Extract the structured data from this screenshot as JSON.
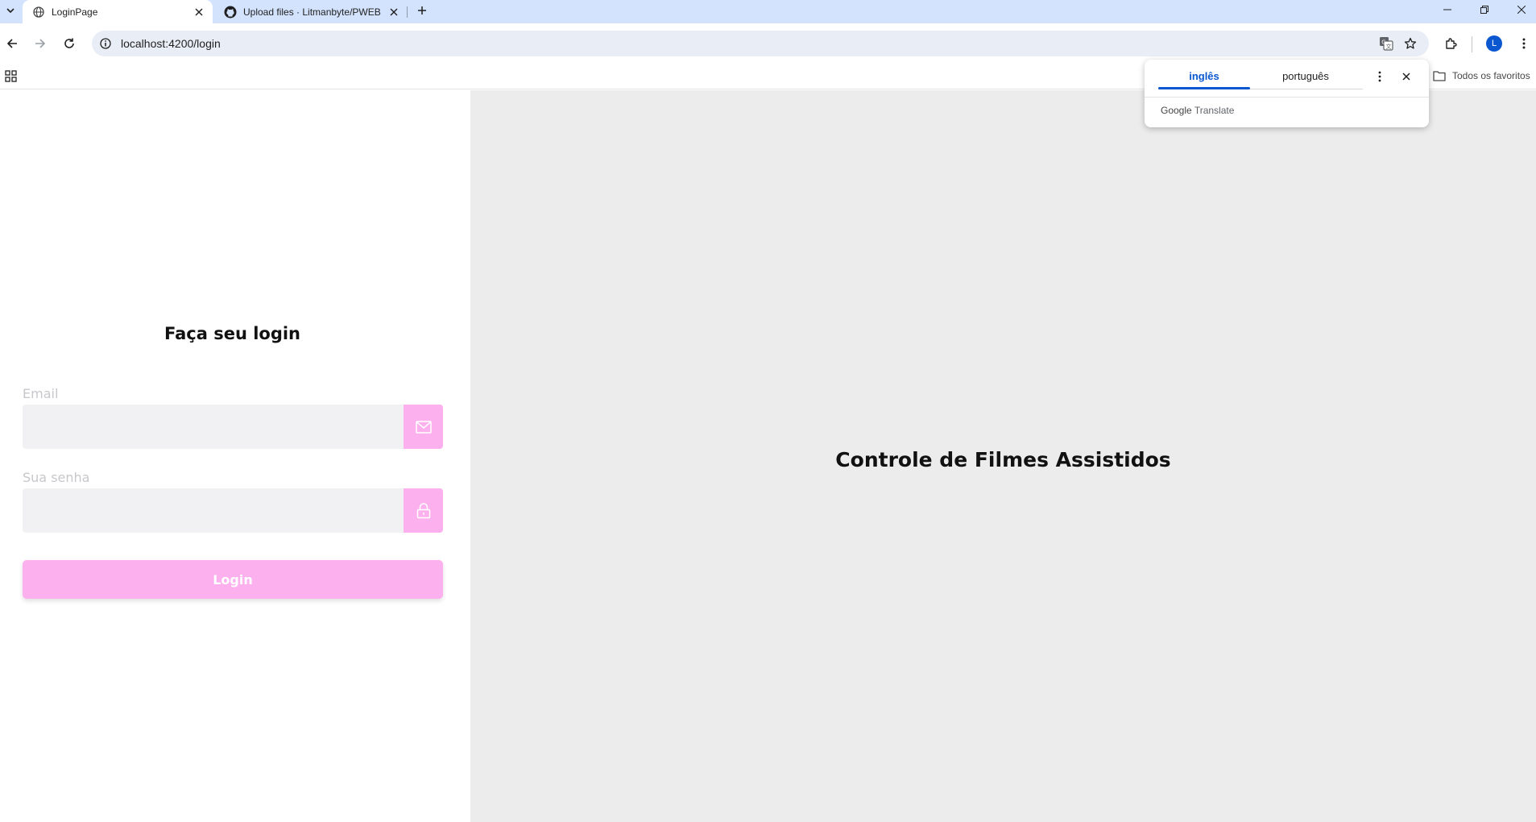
{
  "browser": {
    "tabs": [
      {
        "title": "LoginPage",
        "icon": "globe-icon",
        "active": true
      },
      {
        "title": "Upload files · Litmanbyte/PWEB",
        "icon": "github-icon",
        "active": false
      }
    ],
    "url": "localhost:4200/login",
    "profile_initial": "L",
    "bookmarks": {
      "all_bookmarks_label": "Todos os favoritos"
    }
  },
  "translate_popup": {
    "tabs": [
      {
        "label": "inglês",
        "active": true
      },
      {
        "label": "português",
        "active": false
      }
    ],
    "brand_google": "Google",
    "brand_translate": "Translate"
  },
  "login": {
    "title": "Faça seu login",
    "email_label": "Email",
    "email_value": "",
    "password_label": "Sua senha",
    "password_value": "",
    "submit_label": "Login",
    "accent_color": "#fdb0ee"
  },
  "hero": {
    "title": "Controle de Filmes Assistidos",
    "background_color": "#ececec"
  }
}
